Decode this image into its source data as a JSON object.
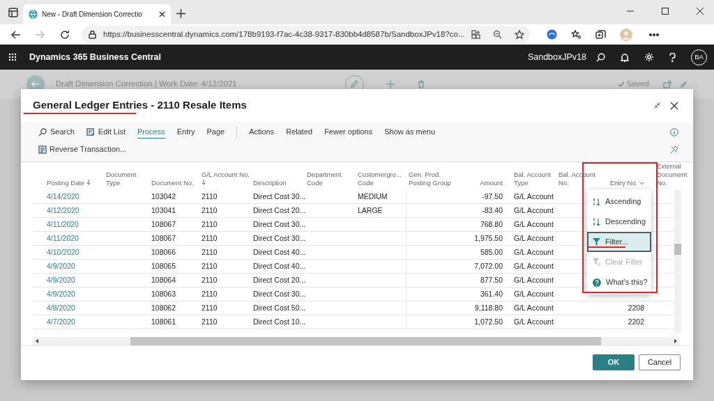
{
  "browser": {
    "tab_title": "New - Draft Dimension Correctio",
    "url": "https://businesscentral.dynamics.com/178b9193-f7ac-4c38-9317-830bb4d8587b/SandboxJPv18?co..."
  },
  "app_bar": {
    "product": "Dynamics 365 Business Central",
    "environment": "SandboxJPv18",
    "avatar": "BA"
  },
  "background_page": {
    "caption": "Draft Dimension Correction | Work Date: 4/12/2021",
    "save_status": "Saved"
  },
  "dialog": {
    "title": "General Ledger Entries - 2110 Resale Items",
    "commands": [
      {
        "kind": "search",
        "label": "Search"
      },
      {
        "kind": "edit",
        "label": "Edit List"
      }
    ],
    "tabs": [
      {
        "label": "Process",
        "selected": true
      },
      {
        "label": "Entry",
        "selected": false
      },
      {
        "label": "Page",
        "selected": false
      }
    ],
    "actions": [
      "Actions",
      "Related",
      "Fewer options",
      "Show as menu"
    ],
    "ribbon_action": "Reverse Transaction...",
    "columns": [
      {
        "label": "Posting Date",
        "sorted": true,
        "menu_open": false
      },
      {
        "label": "Document Type",
        "sorted": false,
        "menu_open": false
      },
      {
        "label": "Document No.",
        "sorted": false,
        "menu_open": false
      },
      {
        "label": "G/L Account No.",
        "sorted": true,
        "menu_open": false
      },
      {
        "label": "Description",
        "sorted": false,
        "menu_open": false
      },
      {
        "label": "Department Code",
        "sorted": false,
        "menu_open": false
      },
      {
        "label": "Customergro... Code",
        "sorted": false,
        "menu_open": false
      },
      {
        "label": "Gen. Prod. Posting Group",
        "sorted": false,
        "menu_open": false
      },
      {
        "label": "Amount",
        "sorted": false,
        "menu_open": false
      },
      {
        "label": "Bal. Account Type",
        "sorted": false,
        "menu_open": false
      },
      {
        "label": "Bal. Account No.",
        "sorted": false,
        "menu_open": false
      },
      {
        "label": "Entry No.",
        "sorted": false,
        "menu_open": true
      },
      {
        "label": "External Document No.",
        "sorted": false,
        "menu_open": false
      }
    ],
    "rows": [
      {
        "posting_date": "4/14/2020",
        "document_no": "103042",
        "account_no": "2110",
        "description": "Direct Cost 30...",
        "customer_group": "MEDIUM",
        "amount": "-97.50",
        "bal_account_type": "G/L Account"
      },
      {
        "posting_date": "4/12/2020",
        "document_no": "103041",
        "account_no": "2110",
        "description": "Direct Cost 20...",
        "customer_group": "LARGE",
        "amount": "-83.40",
        "bal_account_type": "G/L Account"
      },
      {
        "posting_date": "4/11/2020",
        "document_no": "108067",
        "account_no": "2110",
        "description": "Direct Cost 30...",
        "amount": "768.80",
        "bal_account_type": "G/L Account"
      },
      {
        "posting_date": "4/11/2020",
        "document_no": "108067",
        "account_no": "2110",
        "description": "Direct Cost 30...",
        "amount": "1,975.50",
        "bal_account_type": "G/L Account"
      },
      {
        "posting_date": "4/10/2020",
        "document_no": "108066",
        "account_no": "2110",
        "description": "Direct Cost 40...",
        "amount": "585.00",
        "bal_account_type": "G/L Account"
      },
      {
        "posting_date": "4/9/2020",
        "document_no": "108065",
        "account_no": "2110",
        "description": "Direct Cost 40...",
        "amount": "7,072.00",
        "bal_account_type": "G/L Account"
      },
      {
        "posting_date": "4/9/2020",
        "document_no": "108064",
        "account_no": "2110",
        "description": "Direct Cost 20...",
        "amount": "877.50",
        "bal_account_type": "G/L Account"
      },
      {
        "posting_date": "4/9/2020",
        "document_no": "108063",
        "account_no": "2110",
        "description": "Direct Cost 30...",
        "amount": "361.40",
        "bal_account_type": "G/L Account"
      },
      {
        "posting_date": "4/8/2020",
        "document_no": "108062",
        "account_no": "2110",
        "description": "Direct Cost 50...",
        "amount": "9,118.80",
        "bal_account_type": "G/L Account",
        "entry_no": "2208"
      },
      {
        "posting_date": "4/7/2020",
        "document_no": "108061",
        "account_no": "2110",
        "description": "Direct Cost 10...",
        "amount": "1,072.50",
        "bal_account_type": "G/L Account",
        "entry_no": "2202"
      }
    ],
    "column_menu": [
      {
        "kind": "ascending",
        "label": "Ascending",
        "selected": false,
        "disabled": false
      },
      {
        "kind": "descending",
        "label": "Descending",
        "selected": false,
        "disabled": false
      },
      {
        "kind": "filter",
        "label": "Filter...",
        "selected": true,
        "disabled": false
      },
      {
        "kind": "clear-filter",
        "label": "Clear Filter",
        "selected": false,
        "disabled": true
      },
      {
        "kind": "help",
        "label": "What's this?",
        "selected": false,
        "disabled": false
      }
    ],
    "buttons": [
      {
        "kind": "primary",
        "label": "OK"
      },
      {
        "kind": "secondary",
        "label": "Cancel"
      }
    ]
  }
}
